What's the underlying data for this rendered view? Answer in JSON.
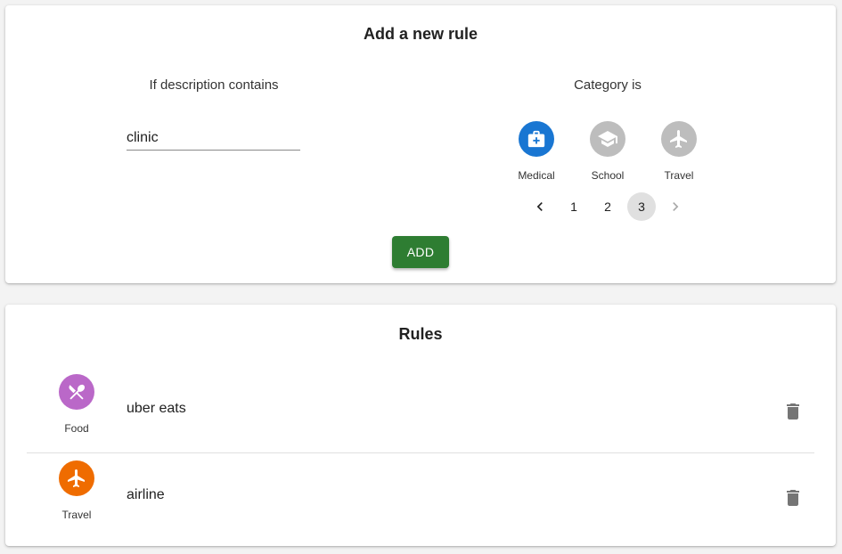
{
  "add_card": {
    "title": "Add a new rule",
    "description_label": "If description contains",
    "description_value": "clinic",
    "category_label": "Category is",
    "categories": [
      {
        "name": "Medical",
        "icon": "medical-bag-icon",
        "color": "#1976d2",
        "selected": true
      },
      {
        "name": "School",
        "icon": "graduation-cap-icon",
        "color": "#bdbdbd",
        "selected": false
      },
      {
        "name": "Travel",
        "icon": "airplane-icon",
        "color": "#bdbdbd",
        "selected": false
      }
    ],
    "pagination": {
      "pages": [
        "1",
        "2",
        "3"
      ],
      "current": "3",
      "prev_icon": "chevron-left-icon",
      "next_icon": "chevron-right-icon"
    },
    "add_label": "ADD",
    "add_color": "#2e7d32"
  },
  "rules_card": {
    "title": "Rules",
    "rules": [
      {
        "category": "Food",
        "icon": "fork-spoon-icon",
        "color": "#ba68c8",
        "text": "uber eats"
      },
      {
        "category": "Travel",
        "icon": "airplane-icon",
        "color": "#ef6c00",
        "text": "airline"
      }
    ],
    "delete_icon": "trash-icon"
  }
}
